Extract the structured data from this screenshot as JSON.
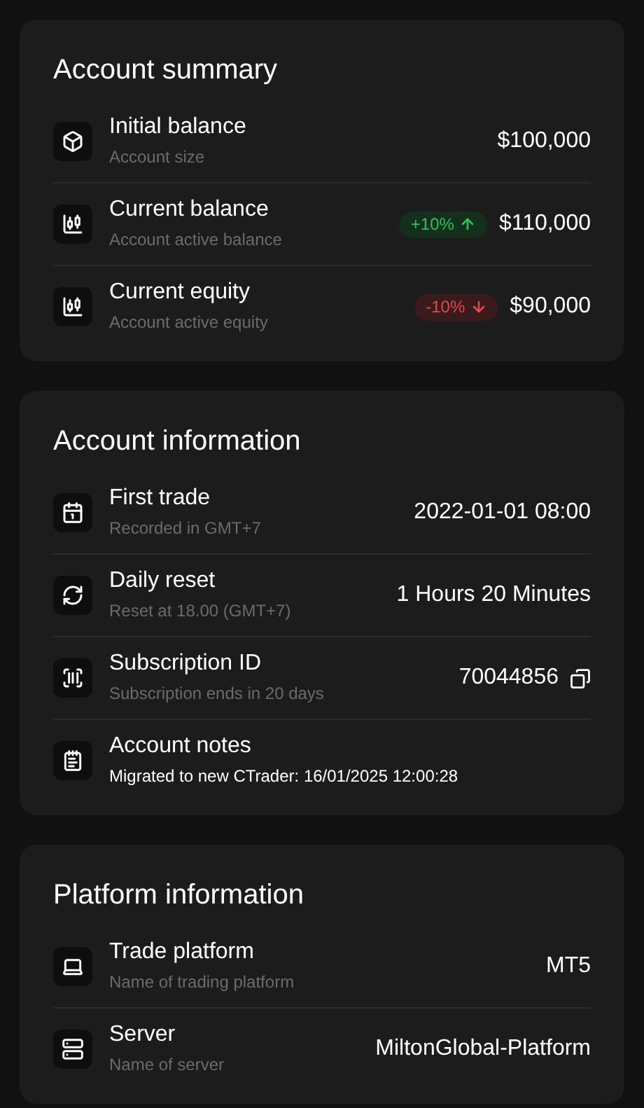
{
  "sections": [
    {
      "title": "Account summary",
      "rows": [
        {
          "kind": "value",
          "label": "Initial balance",
          "sublabel": "Account size",
          "value": "$100,000"
        },
        {
          "kind": "change",
          "label": "Current balance",
          "sublabel": "Account active balance",
          "change": "+10%",
          "positive": true,
          "value": "$110,000"
        },
        {
          "kind": "change",
          "label": "Current equity",
          "sublabel": "Account active equity",
          "change": "-10%",
          "positive": false,
          "value": "$90,000"
        }
      ]
    },
    {
      "title": "Account information",
      "rows": [
        {
          "kind": "value",
          "label": "First trade",
          "sublabel": "Recorded in GMT+7",
          "value": "2022-01-01 08:00"
        },
        {
          "kind": "value",
          "label": "Daily reset",
          "sublabel": "Reset at 18.00 (GMT+7)",
          "value": "1 Hours 20 Minutes"
        },
        {
          "kind": "copy",
          "label": "Subscription ID",
          "sublabel": "Subscription ends in 20 days",
          "value": "70044856"
        },
        {
          "kind": "note",
          "label": "Account notes",
          "note": "Migrated to new CTrader: 16/01/2025 12:00:28"
        }
      ]
    },
    {
      "title": "Platform information",
      "rows": [
        {
          "kind": "value",
          "label": "Trade platform",
          "sublabel": "Name of trading platform",
          "value": "MT5"
        },
        {
          "kind": "value",
          "label": "Server",
          "sublabel": "Name of server",
          "value": "MiltonGlobal-Platform"
        }
      ]
    }
  ]
}
